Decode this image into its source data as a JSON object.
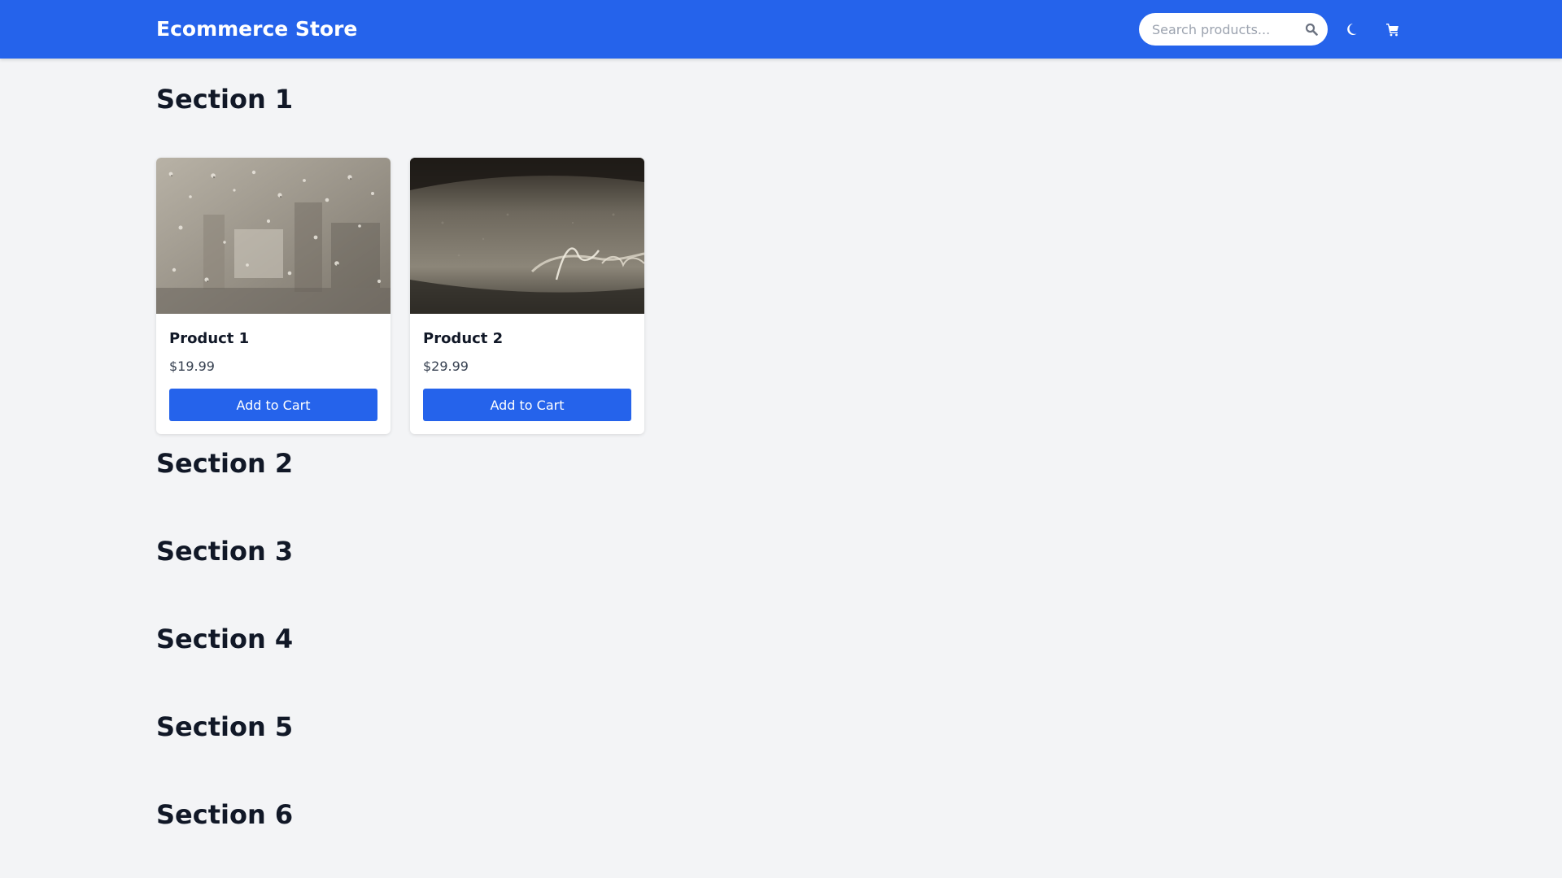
{
  "header": {
    "brand": "Ecommerce Store",
    "search": {
      "placeholder": "Search products...",
      "value": ""
    },
    "icons": {
      "search": "search-icon",
      "theme": "moon-icon",
      "cart": "cart-icon"
    }
  },
  "colors": {
    "primary": "#2563eb",
    "background": "#f3f4f6",
    "card": "#ffffff",
    "text": "#111827"
  },
  "sections": [
    {
      "title": "Section 1",
      "products": [
        {
          "name": "Product 1",
          "price": "$19.99",
          "button": "Add to Cart"
        },
        {
          "name": "Product 2",
          "price": "$29.99",
          "button": "Add to Cart"
        }
      ]
    },
    {
      "title": "Section 2"
    },
    {
      "title": "Section 3"
    },
    {
      "title": "Section 4"
    },
    {
      "title": "Section 5"
    },
    {
      "title": "Section 6"
    }
  ]
}
